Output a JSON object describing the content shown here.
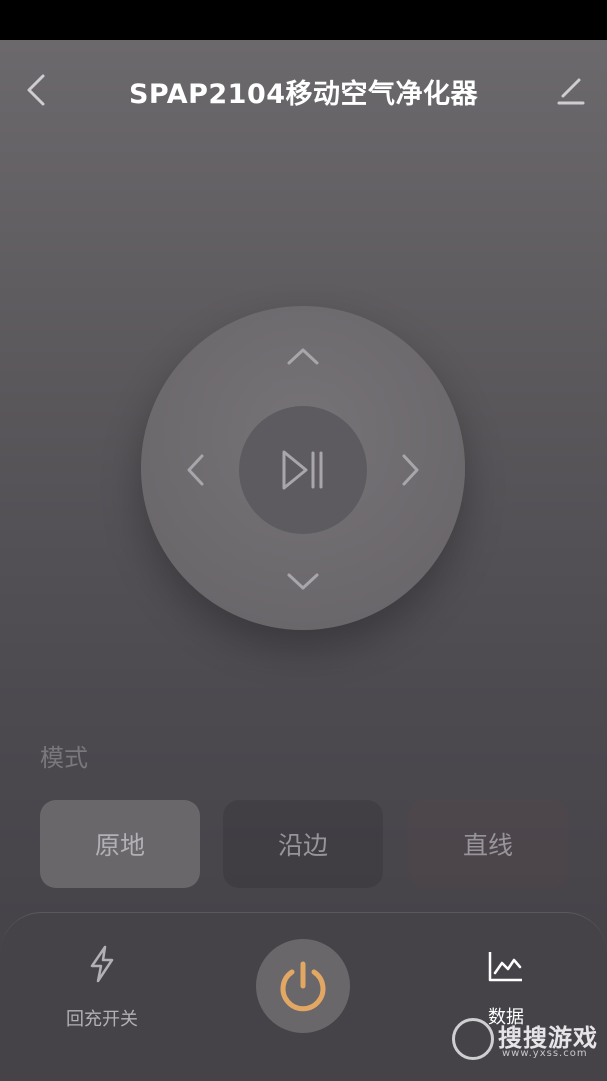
{
  "header": {
    "title": "SPAP2104移动空气净化器",
    "back_icon": "chevron-left-icon",
    "edit_icon": "pencil-icon"
  },
  "dpad": {
    "up_icon": "chevron-up-icon",
    "down_icon": "chevron-down-icon",
    "left_icon": "chevron-left-icon",
    "right_icon": "chevron-right-icon",
    "center_icon": "play-pause-icon"
  },
  "mode": {
    "label": "模式",
    "options": [
      "原地",
      "沿边",
      "直线"
    ],
    "selected": "原地"
  },
  "bottom": {
    "recharge_label": "回充开关",
    "recharge_icon": "lightning-icon",
    "power_icon": "power-icon",
    "data_label": "数据",
    "data_icon": "line-chart-icon"
  },
  "watermark": {
    "text": "搜搜游戏",
    "url": "www.yxss.com"
  },
  "colors": {
    "power_accent": "#e3a764",
    "icon_light": "#a9a6ab"
  }
}
